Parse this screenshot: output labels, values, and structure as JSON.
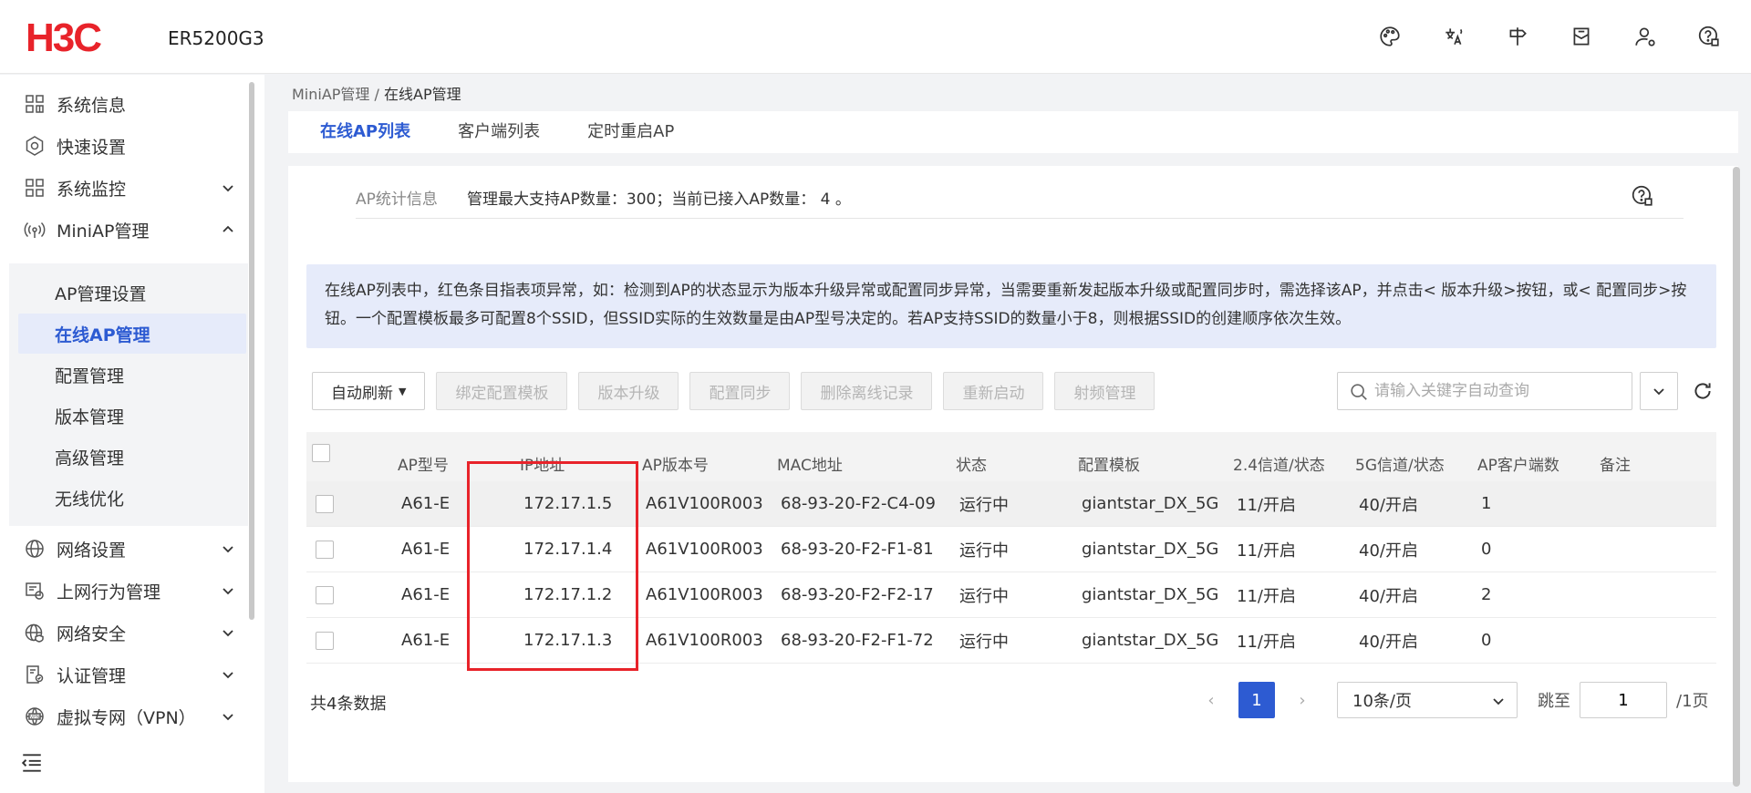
{
  "header": {
    "logo_text": "H3C",
    "model": "ER5200G3",
    "brand_color": "#e8232a"
  },
  "sidebar": {
    "items": [
      {
        "label": "系统信息",
        "icon": "grid-icon"
      },
      {
        "label": "快速设置",
        "icon": "gear-icon"
      },
      {
        "label": "系统监控",
        "icon": "monitor-grid-icon"
      },
      {
        "label": "MiniAP管理",
        "icon": "wifi-ap-icon"
      },
      {
        "label": "网络设置",
        "icon": "globe-icon"
      },
      {
        "label": "上网行为管理",
        "icon": "behavior-icon"
      },
      {
        "label": "网络安全",
        "icon": "security-globe-icon"
      },
      {
        "label": "认证管理",
        "icon": "auth-icon"
      },
      {
        "label": "虚拟专网（VPN）",
        "icon": "vpn-icon"
      }
    ],
    "submenu": [
      {
        "label": "AP管理设置"
      },
      {
        "label": "在线AP管理"
      },
      {
        "label": "配置管理"
      },
      {
        "label": "版本管理"
      },
      {
        "label": "高级管理"
      },
      {
        "label": "无线优化"
      }
    ]
  },
  "breadcrumb": {
    "parent": "MiniAP管理 / ",
    "current": "在线AP管理"
  },
  "tabs": [
    "在线AP列表",
    "客户端列表",
    "定时重启AP"
  ],
  "stats": {
    "label": "AP统计信息",
    "value": "管理最大支持AP数量：300；当前已接入AP数量： 4 。"
  },
  "notice": "在线AP列表中，红色条目指表项异常，如：检测到AP的状态显示为版本升级异常或配置同步异常，当需要重新发起版本升级或配置同步时，需选择该AP，并点击< 版本升级>按钮，或< 配置同步>按钮。一个配置模板最多可配置8个SSID，但SSID实际的生效数量是由AP型号决定的。若AP支持SSID的数量小于8，则根据SSID的创建顺序依次生效。",
  "toolbar": {
    "auto_refresh": "自动刷新",
    "bind_template": "绑定配置模板",
    "upgrade": "版本升级",
    "sync": "配置同步",
    "delete_offline": "删除离线记录",
    "restart": "重新启动",
    "radio": "射频管理",
    "search_placeholder": "请输入关键字自动查询"
  },
  "table": {
    "columns": [
      "AP型号",
      "IP地址",
      "AP版本号",
      "MAC地址",
      "状态",
      "配置模板",
      "2.4信道/状态",
      "5G信道/状态",
      "AP客户端数",
      "备注"
    ],
    "rows": [
      [
        "A61-E",
        "172.17.1.5",
        "A61V100R003",
        "68-93-20-F2-C4-09",
        "运行中",
        "giantstar_DX_5G",
        "11/开启",
        "40/开启",
        "1",
        ""
      ],
      [
        "A61-E",
        "172.17.1.4",
        "A61V100R003",
        "68-93-20-F2-F1-81",
        "运行中",
        "giantstar_DX_5G",
        "11/开启",
        "40/开启",
        "0",
        ""
      ],
      [
        "A61-E",
        "172.17.1.2",
        "A61V100R003",
        "68-93-20-F2-F2-17",
        "运行中",
        "giantstar_DX_5G",
        "11/开启",
        "40/开启",
        "2",
        ""
      ],
      [
        "A61-E",
        "172.17.1.3",
        "A61V100R003",
        "68-93-20-F2-F1-72",
        "运行中",
        "giantstar_DX_5G",
        "11/开启",
        "40/开启",
        "0",
        ""
      ]
    ]
  },
  "footer": {
    "total": "共4条数据",
    "current_page": "1",
    "page_size": "10条/页",
    "goto_label": "跳至",
    "goto_value": "1",
    "total_pages": "/1页"
  },
  "colors": {
    "accent": "#2d5bd2",
    "highlight_box": "#e8232a"
  }
}
